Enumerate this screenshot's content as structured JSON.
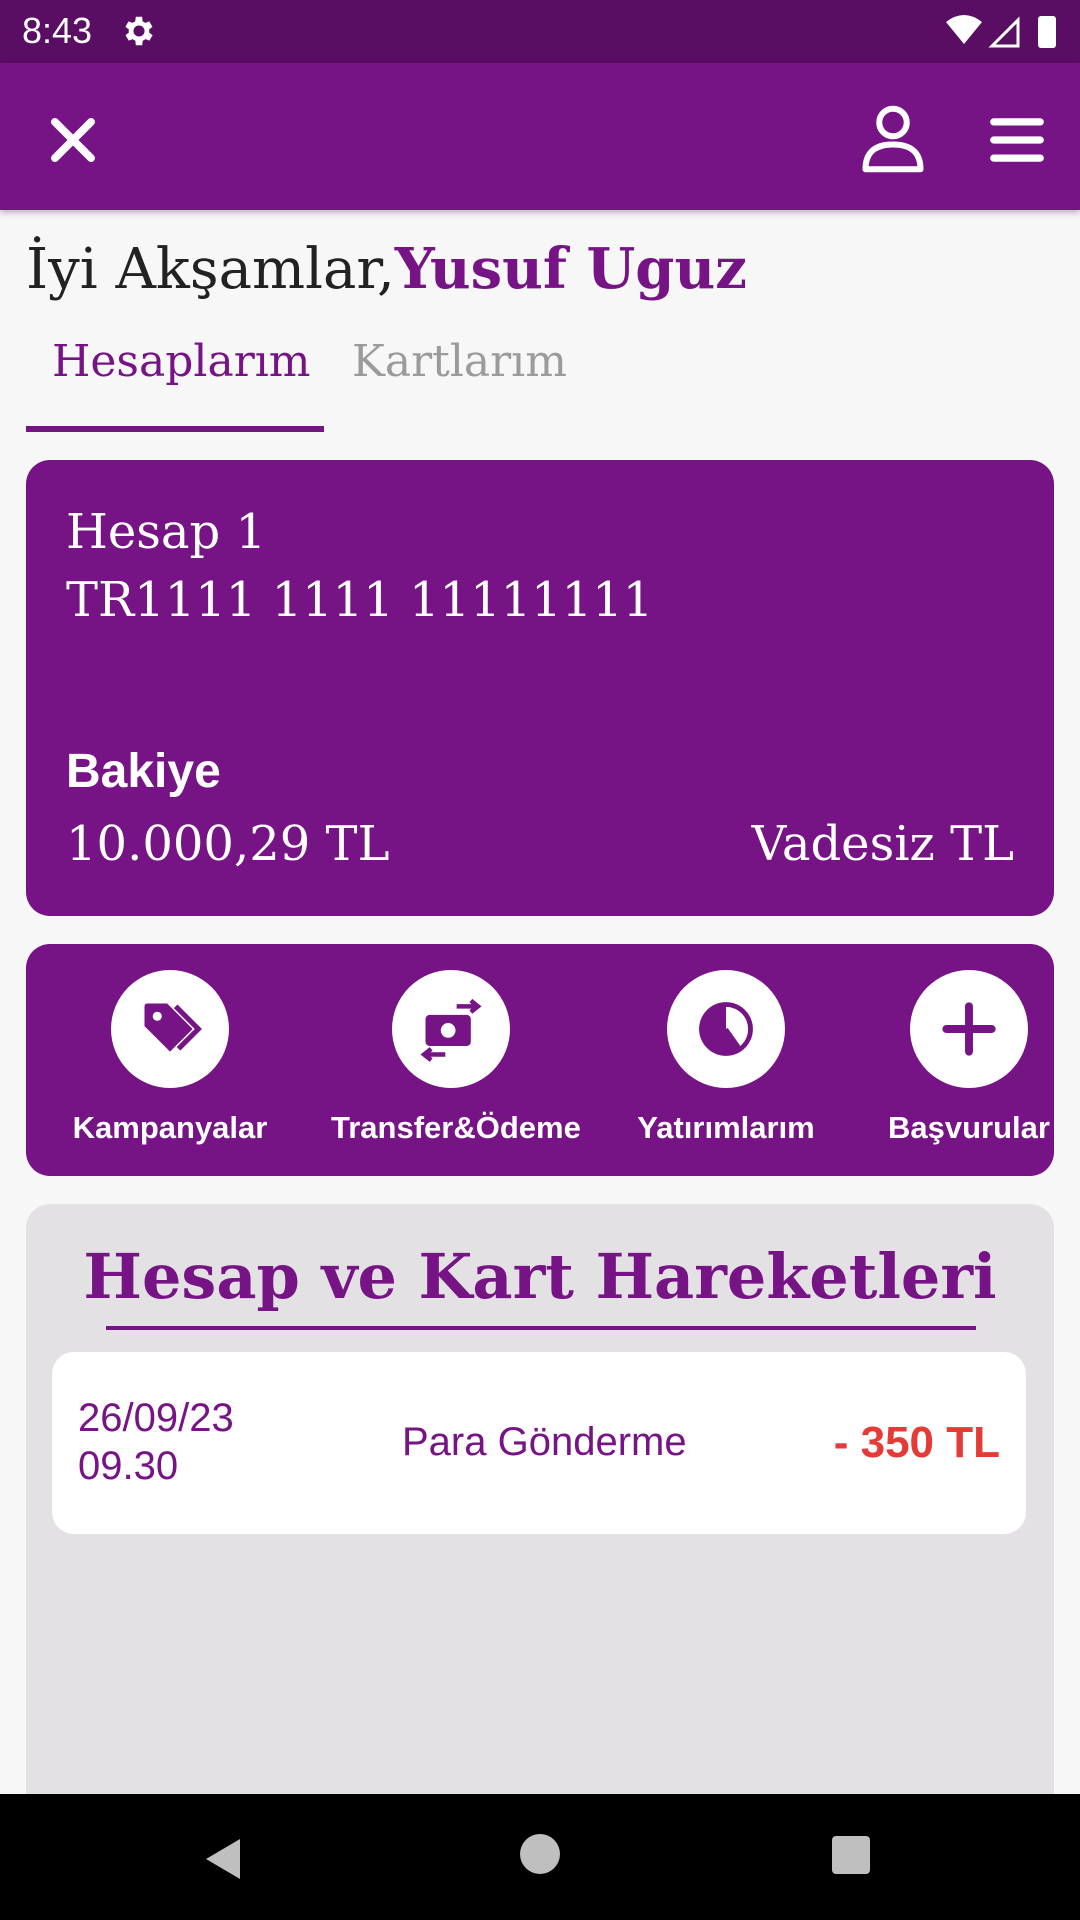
{
  "status_bar": {
    "time": "8:43"
  },
  "app_bar": {},
  "greeting": {
    "prefix": "İyi Akşamlar,",
    "name": "Yusuf Uguz"
  },
  "tabs": [
    {
      "label": "Hesaplarım",
      "active": true
    },
    {
      "label": "Kartlarım",
      "active": false
    }
  ],
  "account": {
    "name": "Hesap 1",
    "iban": "TR1111 1111 11111111",
    "balance_label": "Bakiye",
    "balance_value": "10.000,29 TL",
    "type": "Vadesiz TL"
  },
  "quick_actions": [
    {
      "label": "Kampanyalar",
      "icon": "tag-icon"
    },
    {
      "label": "Transfer&Ödeme",
      "icon": "money-transfer-icon"
    },
    {
      "label": "Yatırımlarım",
      "icon": "pie-chart-icon"
    },
    {
      "label": "Başvurular",
      "icon": "plus-icon"
    }
  ],
  "history": {
    "title": "Hesap ve Kart Hareketleri",
    "transactions": [
      {
        "date": "26/09/23",
        "time": "09.30",
        "description": "Para Gönderme",
        "amount": "- 350 TL"
      }
    ]
  },
  "colors": {
    "primary": "#761385",
    "status_bar": "#5a0e63",
    "negative_amount": "#e53a36",
    "history_bg": "#e3e1e3"
  }
}
